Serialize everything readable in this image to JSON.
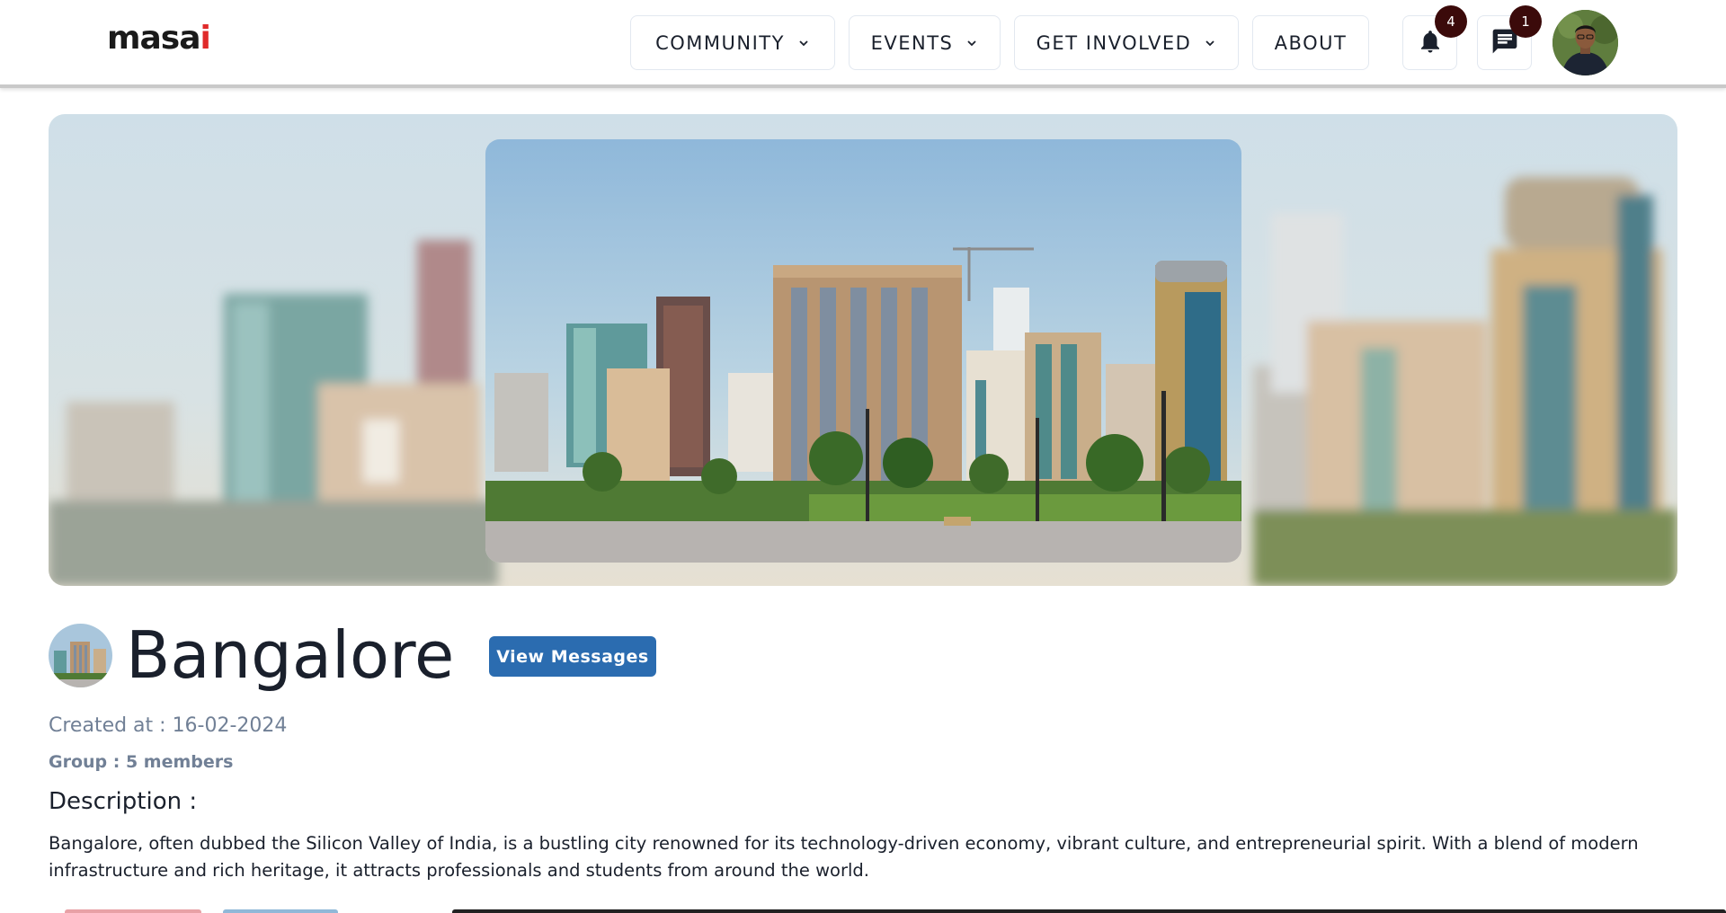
{
  "header": {
    "logo_text": "masa",
    "logo_dot_text": "i",
    "nav": [
      {
        "label": "COMMUNITY",
        "has_dropdown": true
      },
      {
        "label": "EVENTS",
        "has_dropdown": true
      },
      {
        "label": "GET INVOLVED",
        "has_dropdown": true
      },
      {
        "label": "ABOUT",
        "has_dropdown": false
      }
    ],
    "notifications": {
      "icon": "bell-icon",
      "count": "4"
    },
    "messages": {
      "icon": "chat-icon",
      "count": "1"
    },
    "avatar_icon": "user-avatar"
  },
  "group": {
    "name": "Bangalore",
    "view_button_label": "View Messages",
    "created_text": "Created at : 16-02-2024",
    "members_text": "Group : 5 members",
    "description_label": "Description :",
    "description": "Bangalore, often dubbed the Silicon Valley of India, is a bustling city renowned for its technology-driven economy, vibrant culture, and entrepreneurial spirit. With a blend of modern infrastructure and rich heritage, it attracts professionals and students from around the world."
  },
  "colors": {
    "brand_blue": "#2b6cb0",
    "badge": "#3b0a0a",
    "logo_dot": "#e02a2a",
    "muted_text": "#718096"
  }
}
